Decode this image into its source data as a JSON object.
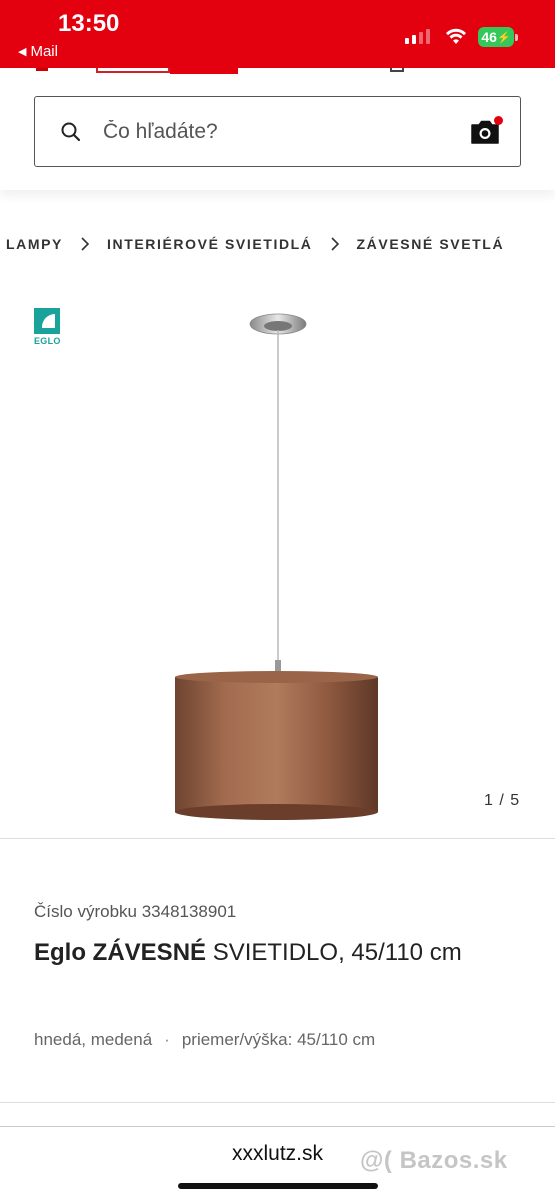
{
  "status_bar": {
    "time": "13:50",
    "back_label": "Mail",
    "battery_level": "46",
    "signal_bars": 2,
    "accent_color": "#e3000f"
  },
  "search": {
    "placeholder": "Čo hľadáte?"
  },
  "breadcrumb": {
    "items": [
      "LAMPY",
      "INTERIÉROVÉ SVIETIDLÁ",
      "ZÁVESNÉ SVETLÁ"
    ]
  },
  "product_image": {
    "brand_logo_text": "EGLO",
    "counter": "1 / 5",
    "lamp_shade_color": "#a0684a"
  },
  "product": {
    "number": "Číslo výrobku 3348138901",
    "brand": "Eglo",
    "category": "ZÁVESNÉ",
    "title_rest": " SVIETIDLO, 45/110 cm",
    "color_attr": "hnedá, medená",
    "dimension_attr": "priemer/výška: 45/110 cm"
  },
  "browser": {
    "url": "xxxlutz.sk",
    "watermark": "@( Bazos.sk"
  }
}
